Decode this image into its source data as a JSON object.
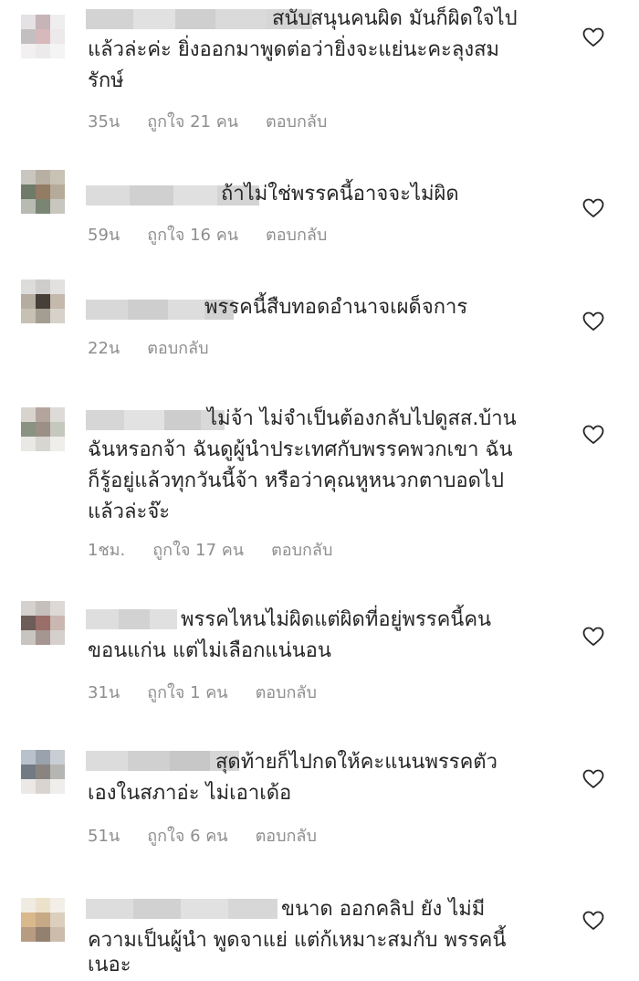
{
  "comments": [
    {
      "lines": [
        "สนับสนุนคนผิด มันก็ผิดใจไป",
        "แล้วล่ะค่ะ ยิ่งออกมาพูดต่อว่ายิ่งจะแย่นะคะลุงสม",
        "รักษ์"
      ],
      "time": "35น",
      "likes": "ถูกใจ 21 คน",
      "reply": "ตอบกลับ",
      "avatar_colors": [
        "#e4e2e4",
        "#c7b4b8",
        "#efeded",
        "#c3bfc0",
        "#d7b8bb",
        "#ede8e9",
        "#f2f0f0",
        "#eceaea",
        "#f5f4f4"
      ]
    },
    {
      "lines": [
        "ถ้าไม่ใช่พรรคนี้อาจจะไม่ผิด"
      ],
      "time": "59น",
      "likes": "ถูกใจ 16 คน",
      "reply": "ตอบกลับ",
      "avatar_colors": [
        "#c9c6bf",
        "#b7b0a3",
        "#c8c2b5",
        "#6f7a68",
        "#927c64",
        "#b6ab99",
        "#b8bbb2",
        "#7b8574",
        "#c8c6bf"
      ]
    },
    {
      "lines": [
        "พรรคนี้สืบทอดอำนาจเผด็จการ"
      ],
      "time": "22น",
      "likes": "",
      "reply": "ตอบกลับ",
      "avatar_colors": [
        "#dcdcda",
        "#cfcdcb",
        "#e2e1df",
        "#b5ad9f",
        "#463e39",
        "#c4b9ab",
        "#c7c1b4",
        "#a39e91",
        "#d6d2ca"
      ]
    },
    {
      "lines": [
        "ไม่จ้า ไม่จำเป็นต้องกลับไปดูสส.บ้าน",
        "ฉันหรอกจ้า ฉันดูผู้นำประเทศกับพรรคพวกเขา ฉัน",
        "ก็รู้อยู่แล้วทุกวันนี้จ้า หรือว่าคุณหูหนวกตาบอดไป",
        "แล้วล่ะจ๊ะ"
      ],
      "time": "1ชม.",
      "likes": "ถูกใจ 17 คน",
      "reply": "ตอบกลับ",
      "avatar_colors": [
        "#d9d3ce",
        "#b3a59e",
        "#dedad7",
        "#8a9382",
        "#9b8f86",
        "#c5c9bd",
        "#e9e8e4",
        "#d8d6d1",
        "#efeeeb"
      ]
    },
    {
      "lines": [
        "พรรคไหนไม่ผิดแต่ผิดที่อยู่พรรคนี้คน",
        "ขอนแก่น แต่ไม่เลือกแน่นอน"
      ],
      "time": "31น",
      "likes": "ถูกใจ 1 คน",
      "reply": "ตอบกลับ",
      "avatar_colors": [
        "#d4d1ce",
        "#c6c0bc",
        "#dcd9d6",
        "#6d5d58",
        "#9a6e69",
        "#cab7b1",
        "#c8c4bf",
        "#a59691",
        "#d6d0cc"
      ]
    },
    {
      "lines": [
        "สุดท้ายก็ไปกดให้คะแนนพรรคตัว",
        "เองในสภาอ่ะ ไม่เอาเด้อ"
      ],
      "time": "51น",
      "likes": "ถูกใจ 6 คน",
      "reply": "ตอบกลับ",
      "avatar_colors": [
        "#b8c1cc",
        "#9aa2ad",
        "#c9ced4",
        "#727b84",
        "#8a8480",
        "#b5b5b3",
        "#ebe8e5",
        "#d9d4cf",
        "#f0eeec"
      ]
    },
    {
      "lines": [
        "ขนาด  ออกคลิป ยัง ไม่มี",
        "ความเป็นผู้นำ พูดจาแย่  แต่ก้เหมาะสมกับ พรรคนี้",
        "เนอะ"
      ],
      "time": "",
      "likes": "",
      "reply": "",
      "avatar_colors": [
        "#f0ebe2",
        "#ece2cc",
        "#f3efe8",
        "#d9b88c",
        "#c7a986",
        "#dccfbd",
        "#b89c82",
        "#94806e",
        "#cbbcab"
      ]
    }
  ]
}
